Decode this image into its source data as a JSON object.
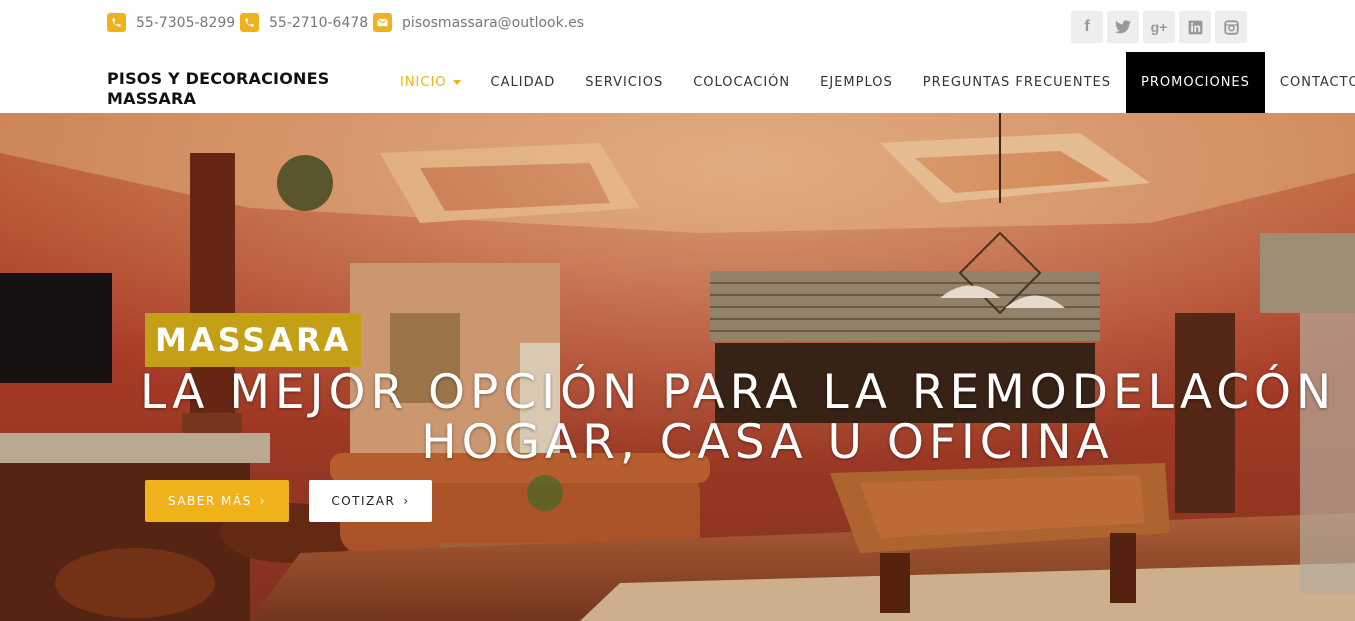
{
  "topbar": {
    "phone1": "55-7305-8299",
    "phone2": "55-2710-6478",
    "email": "pisosmassara@outlook.es",
    "social": [
      {
        "name": "facebook-icon",
        "glyph": "f"
      },
      {
        "name": "twitter-icon",
        "glyph": "t"
      },
      {
        "name": "googleplus-icon",
        "glyph": "g+"
      },
      {
        "name": "linkedin-icon",
        "glyph": "in"
      },
      {
        "name": "instagram-icon",
        "glyph": "◎"
      }
    ]
  },
  "brand": {
    "line1": "PISOS Y DECORACIONES",
    "line2": "MASSARA"
  },
  "nav": {
    "items": [
      {
        "label": "INICIO"
      },
      {
        "label": "CALIDAD"
      },
      {
        "label": "SERVICIOS"
      },
      {
        "label": "COLOCACIÓN"
      },
      {
        "label": "EJEMPLOS"
      },
      {
        "label": "PREGUNTAS FRECUENTES"
      },
      {
        "label": "PROMOCIONES"
      },
      {
        "label": "CONTACTO"
      }
    ]
  },
  "hero": {
    "tag": "MASSARA",
    "title_line1": "LA MEJOR OPCIÓN PARA LA REMODELACÓN DE TU",
    "title_line2": "HOGAR, CASA U OFICINA",
    "btn_primary": "SABER MÁS",
    "btn_secondary": "COTIZAR"
  },
  "colors": {
    "accent": "#f0b21a",
    "tag_bg": "#c4a016",
    "promo_bg": "#000000"
  }
}
